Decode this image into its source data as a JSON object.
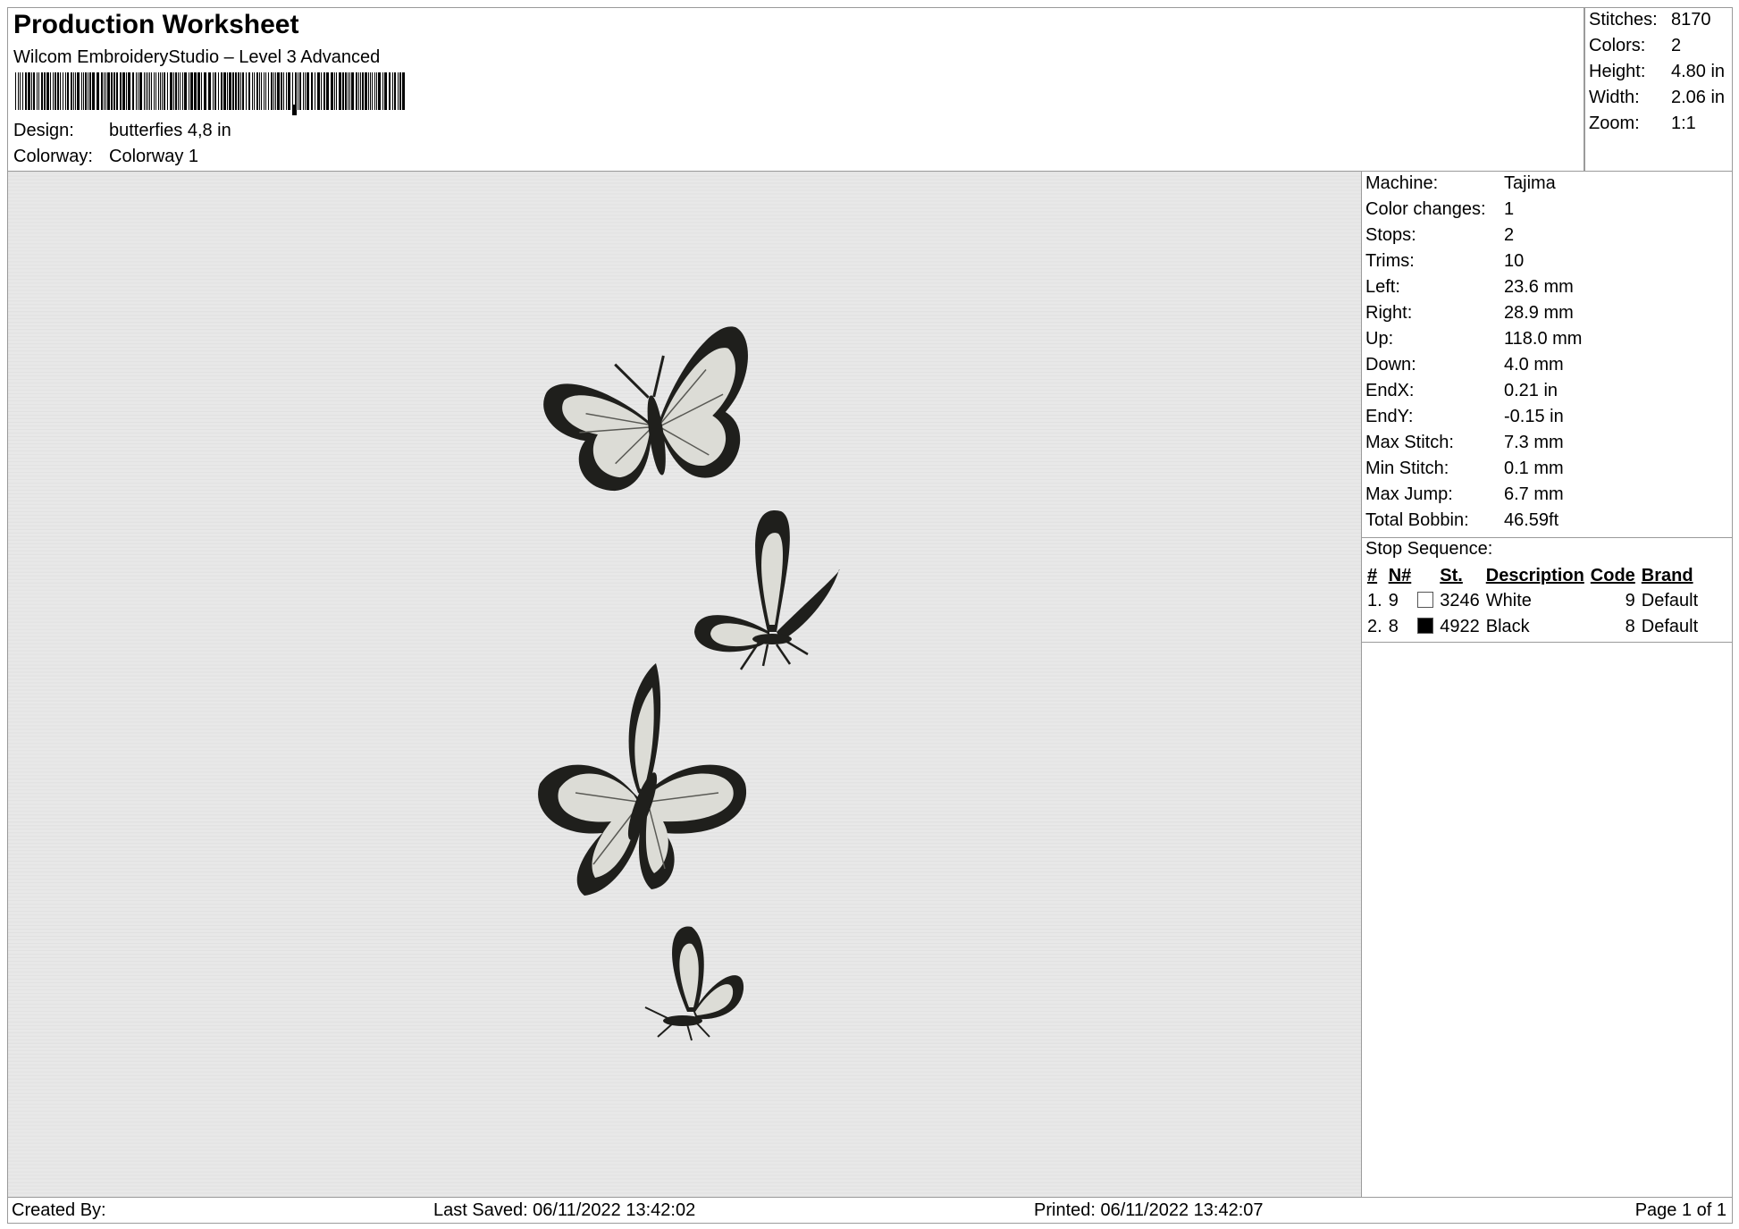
{
  "header": {
    "title": "Production Worksheet",
    "software": "Wilcom EmbroideryStudio – Level 3 Advanced",
    "design_label": "Design:",
    "design_value": "butterfies 4,8 in",
    "colorway_label": "Colorway:",
    "colorway_value": "Colorway 1"
  },
  "summary": {
    "stitches_label": "Stitches:",
    "stitches_value": "8170",
    "colors_label": "Colors:",
    "colors_value": "2",
    "height_label": "Height:",
    "height_value": "4.80 in",
    "width_label": "Width:",
    "width_value": "2.06 in",
    "zoom_label": "Zoom:",
    "zoom_value": "1:1"
  },
  "info": {
    "machine_label": "Machine:",
    "machine_value": "Tajima",
    "color_changes_label": "Color changes:",
    "color_changes_value": "1",
    "stops_label": "Stops:",
    "stops_value": "2",
    "trims_label": "Trims:",
    "trims_value": "10",
    "left_label": "Left:",
    "left_value": "23.6 mm",
    "right_label": "Right:",
    "right_value": "28.9 mm",
    "up_label": "Up:",
    "up_value": "118.0 mm",
    "down_label": "Down:",
    "down_value": "4.0 mm",
    "endx_label": "EndX:",
    "endx_value": "0.21 in",
    "endy_label": "EndY:",
    "endy_value": "-0.15 in",
    "max_stitch_label": "Max Stitch:",
    "max_stitch_value": "7.3 mm",
    "min_stitch_label": "Min Stitch:",
    "min_stitch_value": "0.1 mm",
    "max_jump_label": "Max Jump:",
    "max_jump_value": "6.7 mm",
    "total_bobbin_label": "Total Bobbin:",
    "total_bobbin_value": "46.59ft"
  },
  "stop_sequence": {
    "heading": "Stop Sequence:",
    "columns": {
      "idx": "#",
      "n": "N#",
      "st": "St.",
      "description": "Description",
      "code": "Code",
      "brand": "Brand"
    },
    "rows": [
      {
        "idx": "1.",
        "n": "9",
        "swatch_color": "#ffffff",
        "st": "3246",
        "description": "White",
        "code": "9",
        "brand": "Default"
      },
      {
        "idx": "2.",
        "n": "8",
        "swatch_color": "#000000",
        "st": "4922",
        "description": "Black",
        "code": "8",
        "brand": "Default"
      }
    ]
  },
  "footer": {
    "created_by": "Created By:",
    "last_saved": "Last Saved: 06/11/2022 13:42:02",
    "printed": "Printed: 06/11/2022 13:42:07",
    "page": "Page 1 of 1"
  },
  "colors": {
    "border": "#9a9a9a",
    "canvas_bg": "#e8e8e8",
    "thread_black": "#1f1f1c",
    "thread_white": "#dcdcd6"
  }
}
